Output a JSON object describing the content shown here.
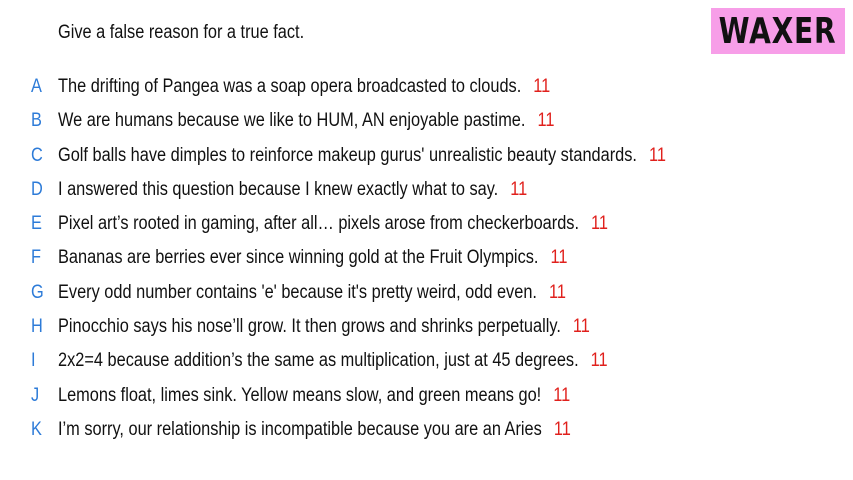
{
  "prompt": "Give a false reason for a true fact.",
  "logo": {
    "text": "WAXER",
    "color": "#f79ee8"
  },
  "colors": {
    "letter": "#2d7bd8",
    "score": "#e0201c",
    "text": "#111111"
  },
  "answers": [
    {
      "letter": "A",
      "text": "The drifting of Pangea was a soap opera broadcasted to clouds.",
      "score": "11"
    },
    {
      "letter": "B",
      "text": "We are humans because we like to HUM, AN enjoyable pastime.",
      "score": "11"
    },
    {
      "letter": "C",
      "text": "Golf balls have dimples to reinforce makeup gurus' unrealistic beauty standards.",
      "score": "11"
    },
    {
      "letter": "D",
      "text": "I answered this question because I knew exactly what to say.",
      "score": "11"
    },
    {
      "letter": "E",
      "text": "Pixel art’s rooted in gaming, after all… pixels arose from checkerboards.",
      "score": "11"
    },
    {
      "letter": "F",
      "text": "Bananas are berries ever since winning gold at the Fruit Olympics.",
      "score": "11"
    },
    {
      "letter": "G",
      "text": "Every odd number contains 'e' because it's pretty weird, odd even.",
      "score": "11"
    },
    {
      "letter": "H",
      "text": "Pinocchio says his nose’ll grow. It then grows and shrinks perpetually.",
      "score": "11"
    },
    {
      "letter": "I",
      "text": "2x2=4 because addition’s the same as multiplication, just at 45 degrees.",
      "score": "11"
    },
    {
      "letter": "J",
      "text": "Lemons float, limes sink. Yellow means slow, and green means go!",
      "score": "11"
    },
    {
      "letter": "K",
      "text": "I’m sorry, our relationship is incompatible because you are an Aries",
      "score": "11"
    }
  ]
}
